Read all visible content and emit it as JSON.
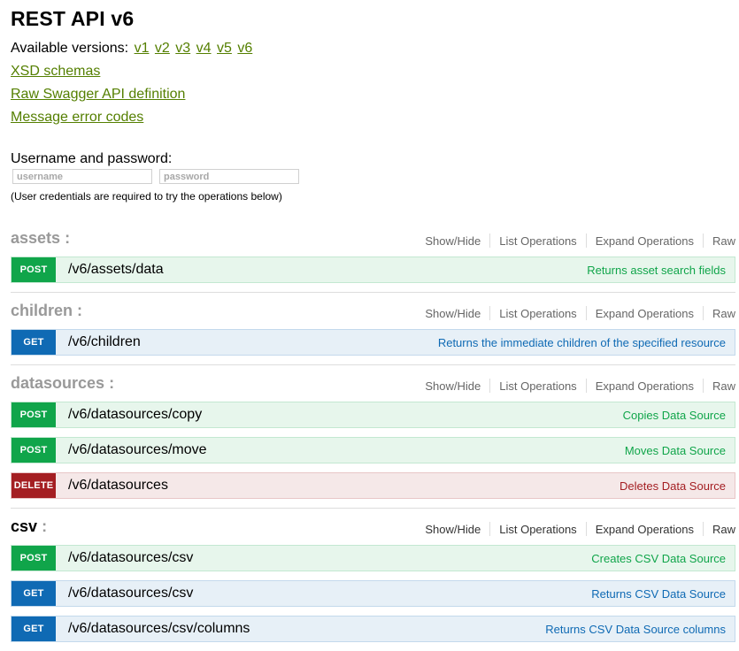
{
  "title": "REST API v6",
  "versions": {
    "label": "Available versions:",
    "items": [
      "v1",
      "v2",
      "v3",
      "v4",
      "v5",
      "v6"
    ]
  },
  "links": {
    "xsd": "XSD schemas",
    "swagger": "Raw Swagger API definition",
    "errors": "Message error codes"
  },
  "credentials": {
    "label": "Username and password:",
    "username_placeholder": "username",
    "password_placeholder": "password",
    "hint": "(User credentials are required to try the operations below)"
  },
  "resource_links": {
    "show_hide": "Show/Hide",
    "list": "List Operations",
    "expand": "Expand Operations",
    "raw": "Raw"
  },
  "resources": [
    {
      "name": "assets",
      "colon": ":",
      "ops": [
        {
          "method": "POST",
          "path": "/v6/assets/data",
          "summary": "Returns asset search fields"
        }
      ]
    },
    {
      "name": "children",
      "colon": ":",
      "ops": [
        {
          "method": "GET",
          "path": "/v6/children",
          "summary": "Returns the immediate children of the specified resource"
        }
      ]
    },
    {
      "name": "datasources",
      "colon": ":",
      "ops": [
        {
          "method": "POST",
          "path": "/v6/datasources/copy",
          "summary": "Copies Data Source"
        },
        {
          "method": "POST",
          "path": "/v6/datasources/move",
          "summary": "Moves Data Source"
        },
        {
          "method": "DELETE",
          "path": "/v6/datasources",
          "summary": "Deletes Data Source"
        }
      ]
    },
    {
      "name": "csv",
      "colon": ":",
      "ops": [
        {
          "method": "POST",
          "path": "/v6/datasources/csv",
          "summary": "Creates CSV Data Source"
        },
        {
          "method": "GET",
          "path": "/v6/datasources/csv",
          "summary": "Returns CSV Data Source"
        },
        {
          "method": "GET",
          "path": "/v6/datasources/csv/columns",
          "summary": "Returns CSV Data Source columns"
        }
      ]
    }
  ],
  "colors": {
    "link": "#547f00",
    "post": "#10a54a",
    "get": "#0f6ab4",
    "delete": "#a41e22"
  }
}
